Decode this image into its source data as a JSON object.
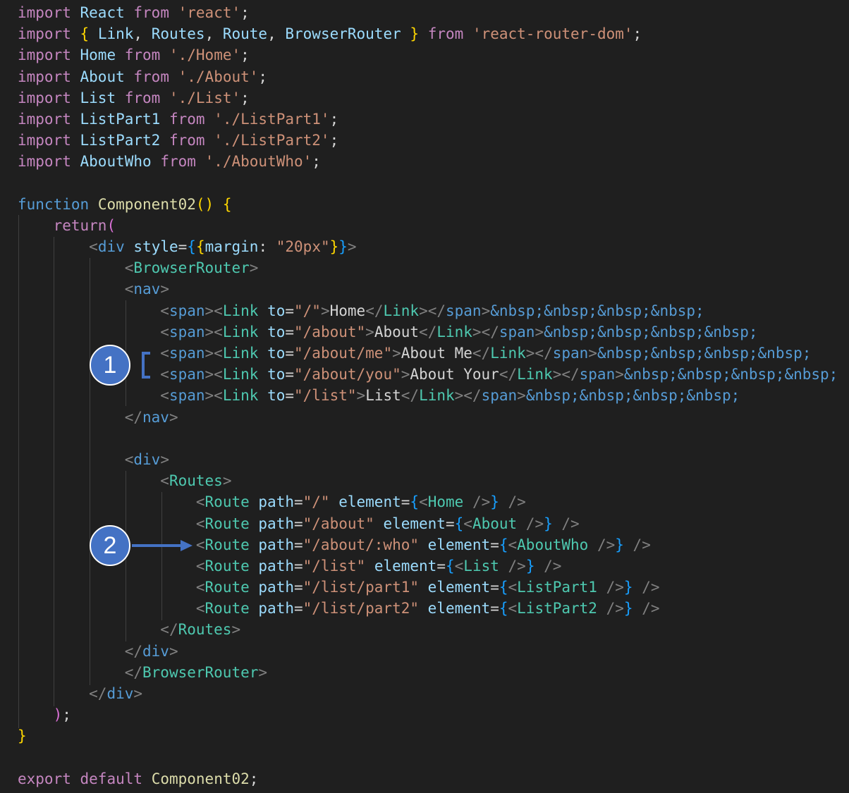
{
  "colors": {
    "background": "#1f1f1f",
    "keyword": "#c586c0",
    "storage": "#569cd6",
    "variable": "#9cdcfe",
    "string": "#ce9178",
    "function": "#dcdcaa",
    "component": "#4ec9b0",
    "punctuation": "#808080",
    "text": "#d4d4d4",
    "bracket1": "#ffd700",
    "bracket2": "#da70d6",
    "bracket3": "#179fff",
    "annotation": "#4472c4"
  },
  "annotations": {
    "badge1": "1",
    "badge2": "2"
  },
  "code_lines": [
    [
      [
        "import",
        "keyword"
      ],
      [
        " ",
        "text"
      ],
      [
        "React",
        "variable"
      ],
      [
        " ",
        "text"
      ],
      [
        "from",
        "keyword"
      ],
      [
        " ",
        "text"
      ],
      [
        "'react'",
        "string"
      ],
      [
        ";",
        "text"
      ]
    ],
    [
      [
        "import",
        "keyword"
      ],
      [
        " ",
        "text"
      ],
      [
        "{",
        "bracket1"
      ],
      [
        " ",
        "text"
      ],
      [
        "Link",
        "variable"
      ],
      [
        ", ",
        "text"
      ],
      [
        "Routes",
        "variable"
      ],
      [
        ", ",
        "text"
      ],
      [
        "Route",
        "variable"
      ],
      [
        ", ",
        "text"
      ],
      [
        "BrowserRouter",
        "variable"
      ],
      [
        " ",
        "text"
      ],
      [
        "}",
        "bracket1"
      ],
      [
        " ",
        "text"
      ],
      [
        "from",
        "keyword"
      ],
      [
        " ",
        "text"
      ],
      [
        "'react-router-dom'",
        "string"
      ],
      [
        ";",
        "text"
      ]
    ],
    [
      [
        "import",
        "keyword"
      ],
      [
        " ",
        "text"
      ],
      [
        "Home",
        "variable"
      ],
      [
        " ",
        "text"
      ],
      [
        "from",
        "keyword"
      ],
      [
        " ",
        "text"
      ],
      [
        "'./Home'",
        "string"
      ],
      [
        ";",
        "text"
      ]
    ],
    [
      [
        "import",
        "keyword"
      ],
      [
        " ",
        "text"
      ],
      [
        "About",
        "variable"
      ],
      [
        " ",
        "text"
      ],
      [
        "from",
        "keyword"
      ],
      [
        " ",
        "text"
      ],
      [
        "'./About'",
        "string"
      ],
      [
        ";",
        "text"
      ]
    ],
    [
      [
        "import",
        "keyword"
      ],
      [
        " ",
        "text"
      ],
      [
        "List",
        "variable"
      ],
      [
        " ",
        "text"
      ],
      [
        "from",
        "keyword"
      ],
      [
        " ",
        "text"
      ],
      [
        "'./List'",
        "string"
      ],
      [
        ";",
        "text"
      ]
    ],
    [
      [
        "import",
        "keyword"
      ],
      [
        " ",
        "text"
      ],
      [
        "ListPart1",
        "variable"
      ],
      [
        " ",
        "text"
      ],
      [
        "from",
        "keyword"
      ],
      [
        " ",
        "text"
      ],
      [
        "'./ListPart1'",
        "string"
      ],
      [
        ";",
        "text"
      ]
    ],
    [
      [
        "import",
        "keyword"
      ],
      [
        " ",
        "text"
      ],
      [
        "ListPart2",
        "variable"
      ],
      [
        " ",
        "text"
      ],
      [
        "from",
        "keyword"
      ],
      [
        " ",
        "text"
      ],
      [
        "'./ListPart2'",
        "string"
      ],
      [
        ";",
        "text"
      ]
    ],
    [
      [
        "import",
        "keyword"
      ],
      [
        " ",
        "text"
      ],
      [
        "AboutWho",
        "variable"
      ],
      [
        " ",
        "text"
      ],
      [
        "from",
        "keyword"
      ],
      [
        " ",
        "text"
      ],
      [
        "'./AboutWho'",
        "string"
      ],
      [
        ";",
        "text"
      ]
    ],
    [],
    [
      [
        "function",
        "storage"
      ],
      [
        " ",
        "text"
      ],
      [
        "Component02",
        "function"
      ],
      [
        "()",
        "bracket1"
      ],
      [
        " ",
        "text"
      ],
      [
        "{",
        "bracket1"
      ]
    ],
    [
      [
        "    ",
        "text"
      ],
      [
        "return",
        "keyword"
      ],
      [
        "(",
        "bracket2"
      ]
    ],
    [
      [
        "        ",
        "text"
      ],
      [
        "<",
        "punctuation"
      ],
      [
        "div",
        "storage"
      ],
      [
        " ",
        "text"
      ],
      [
        "style",
        "variable"
      ],
      [
        "=",
        "text"
      ],
      [
        "{",
        "bracket3"
      ],
      [
        "{",
        "bracket1"
      ],
      [
        "margin",
        "variable"
      ],
      [
        ": ",
        "text"
      ],
      [
        "\"20px\"",
        "string"
      ],
      [
        "}",
        "bracket1"
      ],
      [
        "}",
        "bracket3"
      ],
      [
        ">",
        "punctuation"
      ]
    ],
    [
      [
        "            ",
        "text"
      ],
      [
        "<",
        "punctuation"
      ],
      [
        "BrowserRouter",
        "component"
      ],
      [
        ">",
        "punctuation"
      ]
    ],
    [
      [
        "            ",
        "text"
      ],
      [
        "<",
        "punctuation"
      ],
      [
        "nav",
        "storage"
      ],
      [
        ">",
        "punctuation"
      ]
    ],
    [
      [
        "                ",
        "text"
      ],
      [
        "<",
        "punctuation"
      ],
      [
        "span",
        "storage"
      ],
      [
        "><",
        "punctuation"
      ],
      [
        "Link",
        "component"
      ],
      [
        " ",
        "text"
      ],
      [
        "to",
        "variable"
      ],
      [
        "=",
        "text"
      ],
      [
        "\"/\"",
        "string"
      ],
      [
        ">",
        "punctuation"
      ],
      [
        "Home",
        "text"
      ],
      [
        "</",
        "punctuation"
      ],
      [
        "Link",
        "component"
      ],
      [
        "></",
        "punctuation"
      ],
      [
        "span",
        "storage"
      ],
      [
        ">",
        "punctuation"
      ],
      [
        "&nbsp;&nbsp;&nbsp;&nbsp;",
        "storage"
      ]
    ],
    [
      [
        "                ",
        "text"
      ],
      [
        "<",
        "punctuation"
      ],
      [
        "span",
        "storage"
      ],
      [
        "><",
        "punctuation"
      ],
      [
        "Link",
        "component"
      ],
      [
        " ",
        "text"
      ],
      [
        "to",
        "variable"
      ],
      [
        "=",
        "text"
      ],
      [
        "\"/about\"",
        "string"
      ],
      [
        ">",
        "punctuation"
      ],
      [
        "About",
        "text"
      ],
      [
        "</",
        "punctuation"
      ],
      [
        "Link",
        "component"
      ],
      [
        "></",
        "punctuation"
      ],
      [
        "span",
        "storage"
      ],
      [
        ">",
        "punctuation"
      ],
      [
        "&nbsp;&nbsp;&nbsp;&nbsp;",
        "storage"
      ]
    ],
    [
      [
        "                ",
        "text"
      ],
      [
        "<",
        "punctuation"
      ],
      [
        "span",
        "storage"
      ],
      [
        "><",
        "punctuation"
      ],
      [
        "Link",
        "component"
      ],
      [
        " ",
        "text"
      ],
      [
        "to",
        "variable"
      ],
      [
        "=",
        "text"
      ],
      [
        "\"/about/me\"",
        "string"
      ],
      [
        ">",
        "punctuation"
      ],
      [
        "About Me",
        "text"
      ],
      [
        "</",
        "punctuation"
      ],
      [
        "Link",
        "component"
      ],
      [
        "></",
        "punctuation"
      ],
      [
        "span",
        "storage"
      ],
      [
        ">",
        "punctuation"
      ],
      [
        "&nbsp;&nbsp;&nbsp;&nbsp;",
        "storage"
      ]
    ],
    [
      [
        "                ",
        "text"
      ],
      [
        "<",
        "punctuation"
      ],
      [
        "span",
        "storage"
      ],
      [
        "><",
        "punctuation"
      ],
      [
        "Link",
        "component"
      ],
      [
        " ",
        "text"
      ],
      [
        "to",
        "variable"
      ],
      [
        "=",
        "text"
      ],
      [
        "\"/about/you\"",
        "string"
      ],
      [
        ">",
        "punctuation"
      ],
      [
        "About Your",
        "text"
      ],
      [
        "</",
        "punctuation"
      ],
      [
        "Link",
        "component"
      ],
      [
        "></",
        "punctuation"
      ],
      [
        "span",
        "storage"
      ],
      [
        ">",
        "punctuation"
      ],
      [
        "&nbsp;&nbsp;&nbsp;&nbsp;",
        "storage"
      ]
    ],
    [
      [
        "                ",
        "text"
      ],
      [
        "<",
        "punctuation"
      ],
      [
        "span",
        "storage"
      ],
      [
        "><",
        "punctuation"
      ],
      [
        "Link",
        "component"
      ],
      [
        " ",
        "text"
      ],
      [
        "to",
        "variable"
      ],
      [
        "=",
        "text"
      ],
      [
        "\"/list\"",
        "string"
      ],
      [
        ">",
        "punctuation"
      ],
      [
        "List",
        "text"
      ],
      [
        "</",
        "punctuation"
      ],
      [
        "Link",
        "component"
      ],
      [
        "></",
        "punctuation"
      ],
      [
        "span",
        "storage"
      ],
      [
        ">",
        "punctuation"
      ],
      [
        "&nbsp;&nbsp;&nbsp;&nbsp;",
        "storage"
      ]
    ],
    [
      [
        "            ",
        "text"
      ],
      [
        "</",
        "punctuation"
      ],
      [
        "nav",
        "storage"
      ],
      [
        ">",
        "punctuation"
      ]
    ],
    [],
    [
      [
        "            ",
        "text"
      ],
      [
        "<",
        "punctuation"
      ],
      [
        "div",
        "storage"
      ],
      [
        ">",
        "punctuation"
      ]
    ],
    [
      [
        "                ",
        "text"
      ],
      [
        "<",
        "punctuation"
      ],
      [
        "Routes",
        "component"
      ],
      [
        ">",
        "punctuation"
      ]
    ],
    [
      [
        "                    ",
        "text"
      ],
      [
        "<",
        "punctuation"
      ],
      [
        "Route",
        "component"
      ],
      [
        " ",
        "text"
      ],
      [
        "path",
        "variable"
      ],
      [
        "=",
        "text"
      ],
      [
        "\"/\"",
        "string"
      ],
      [
        " ",
        "text"
      ],
      [
        "element",
        "variable"
      ],
      [
        "=",
        "text"
      ],
      [
        "{",
        "bracket3"
      ],
      [
        "<",
        "punctuation"
      ],
      [
        "Home",
        "component"
      ],
      [
        " />",
        "punctuation"
      ],
      [
        "}",
        "bracket3"
      ],
      [
        " />",
        "punctuation"
      ]
    ],
    [
      [
        "                    ",
        "text"
      ],
      [
        "<",
        "punctuation"
      ],
      [
        "Route",
        "component"
      ],
      [
        " ",
        "text"
      ],
      [
        "path",
        "variable"
      ],
      [
        "=",
        "text"
      ],
      [
        "\"/about\"",
        "string"
      ],
      [
        " ",
        "text"
      ],
      [
        "element",
        "variable"
      ],
      [
        "=",
        "text"
      ],
      [
        "{",
        "bracket3"
      ],
      [
        "<",
        "punctuation"
      ],
      [
        "About",
        "component"
      ],
      [
        " />",
        "punctuation"
      ],
      [
        "}",
        "bracket3"
      ],
      [
        " />",
        "punctuation"
      ]
    ],
    [
      [
        "                    ",
        "text"
      ],
      [
        "<",
        "punctuation"
      ],
      [
        "Route",
        "component"
      ],
      [
        " ",
        "text"
      ],
      [
        "path",
        "variable"
      ],
      [
        "=",
        "text"
      ],
      [
        "\"/about/:who\"",
        "string"
      ],
      [
        " ",
        "text"
      ],
      [
        "element",
        "variable"
      ],
      [
        "=",
        "text"
      ],
      [
        "{",
        "bracket3"
      ],
      [
        "<",
        "punctuation"
      ],
      [
        "AboutWho",
        "component"
      ],
      [
        " />",
        "punctuation"
      ],
      [
        "}",
        "bracket3"
      ],
      [
        " />",
        "punctuation"
      ]
    ],
    [
      [
        "                    ",
        "text"
      ],
      [
        "<",
        "punctuation"
      ],
      [
        "Route",
        "component"
      ],
      [
        " ",
        "text"
      ],
      [
        "path",
        "variable"
      ],
      [
        "=",
        "text"
      ],
      [
        "\"/list\"",
        "string"
      ],
      [
        " ",
        "text"
      ],
      [
        "element",
        "variable"
      ],
      [
        "=",
        "text"
      ],
      [
        "{",
        "bracket3"
      ],
      [
        "<",
        "punctuation"
      ],
      [
        "List",
        "component"
      ],
      [
        " />",
        "punctuation"
      ],
      [
        "}",
        "bracket3"
      ],
      [
        " />",
        "punctuation"
      ]
    ],
    [
      [
        "                    ",
        "text"
      ],
      [
        "<",
        "punctuation"
      ],
      [
        "Route",
        "component"
      ],
      [
        " ",
        "text"
      ],
      [
        "path",
        "variable"
      ],
      [
        "=",
        "text"
      ],
      [
        "\"/list/part1\"",
        "string"
      ],
      [
        " ",
        "text"
      ],
      [
        "element",
        "variable"
      ],
      [
        "=",
        "text"
      ],
      [
        "{",
        "bracket3"
      ],
      [
        "<",
        "punctuation"
      ],
      [
        "ListPart1",
        "component"
      ],
      [
        " />",
        "punctuation"
      ],
      [
        "}",
        "bracket3"
      ],
      [
        " />",
        "punctuation"
      ]
    ],
    [
      [
        "                    ",
        "text"
      ],
      [
        "<",
        "punctuation"
      ],
      [
        "Route",
        "component"
      ],
      [
        " ",
        "text"
      ],
      [
        "path",
        "variable"
      ],
      [
        "=",
        "text"
      ],
      [
        "\"/list/part2\"",
        "string"
      ],
      [
        " ",
        "text"
      ],
      [
        "element",
        "variable"
      ],
      [
        "=",
        "text"
      ],
      [
        "{",
        "bracket3"
      ],
      [
        "<",
        "punctuation"
      ],
      [
        "ListPart2",
        "component"
      ],
      [
        " />",
        "punctuation"
      ],
      [
        "}",
        "bracket3"
      ],
      [
        " />",
        "punctuation"
      ]
    ],
    [
      [
        "                ",
        "text"
      ],
      [
        "</",
        "punctuation"
      ],
      [
        "Routes",
        "component"
      ],
      [
        ">",
        "punctuation"
      ]
    ],
    [
      [
        "            ",
        "text"
      ],
      [
        "</",
        "punctuation"
      ],
      [
        "div",
        "storage"
      ],
      [
        ">",
        "punctuation"
      ]
    ],
    [
      [
        "            ",
        "text"
      ],
      [
        "</",
        "punctuation"
      ],
      [
        "BrowserRouter",
        "component"
      ],
      [
        ">",
        "punctuation"
      ]
    ],
    [
      [
        "        ",
        "text"
      ],
      [
        "</",
        "punctuation"
      ],
      [
        "div",
        "storage"
      ],
      [
        ">",
        "punctuation"
      ]
    ],
    [
      [
        "    ",
        "text"
      ],
      [
        ")",
        "bracket2"
      ],
      [
        ";",
        "text"
      ]
    ],
    [
      [
        "}",
        "bracket1"
      ]
    ],
    [],
    [
      [
        "export",
        "keyword"
      ],
      [
        " ",
        "text"
      ],
      [
        "default",
        "keyword"
      ],
      [
        " ",
        "text"
      ],
      [
        "Component02",
        "function"
      ],
      [
        ";",
        "text"
      ]
    ]
  ]
}
